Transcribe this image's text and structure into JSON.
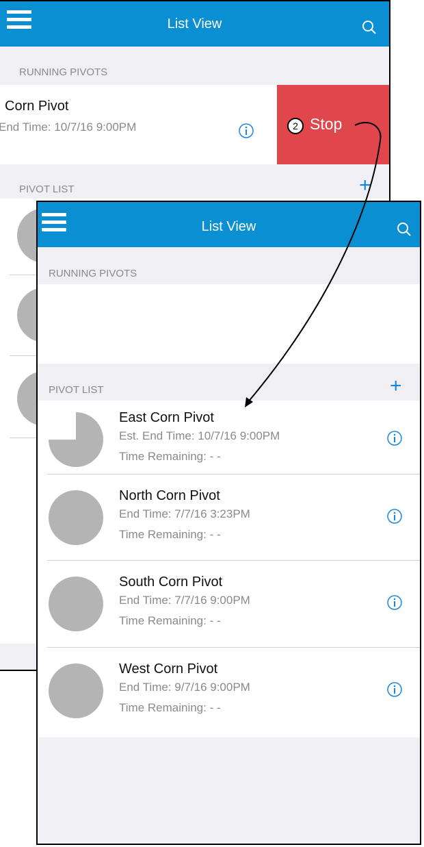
{
  "back": {
    "navbar": {
      "title": "List View"
    },
    "running_section": {
      "label": "RUNNING PIVOTS"
    },
    "running_item": {
      "name": "Corn Pivot",
      "end_time": "End Time: 10/7/16  9:00PM"
    },
    "stop_action": {
      "step_number": "2",
      "label": "Stop",
      "color": "#e0474c"
    },
    "pivot_section": {
      "label": "PIVOT LIST",
      "add_symbol": "+"
    }
  },
  "front": {
    "navbar": {
      "title": "List View"
    },
    "running_section": {
      "label": "RUNNING PIVOTS"
    },
    "pivot_section": {
      "label": "PIVOT LIST",
      "add_symbol": "+"
    },
    "pivots": [
      {
        "name": "East Corn Pivot",
        "end_time": "Est. End Time: 10/7/16  9:00PM",
        "remaining": "Time Remaining: - -",
        "progress": 0.75
      },
      {
        "name": "North Corn Pivot",
        "end_time": "End Time: 7/7/16  3:23PM",
        "remaining": "Time Remaining: - -",
        "progress": 1.0
      },
      {
        "name": "South Corn Pivot",
        "end_time": "End Time: 7/7/16  9:00PM",
        "remaining": "Time Remaining: - -",
        "progress": 1.0
      },
      {
        "name": "West Corn Pivot",
        "end_time": "End Time: 9/7/16  9:00PM",
        "remaining": "Time Remaining: - -",
        "progress": 1.0
      }
    ]
  },
  "colors": {
    "accent": "#0a8fd3",
    "stop": "#e0474c",
    "pie": "#b4b4b4",
    "info": "#1686e0"
  },
  "icons": [
    "menu-icon",
    "search-icon",
    "info-icon",
    "plus-icon",
    "pie-progress-icon"
  ]
}
